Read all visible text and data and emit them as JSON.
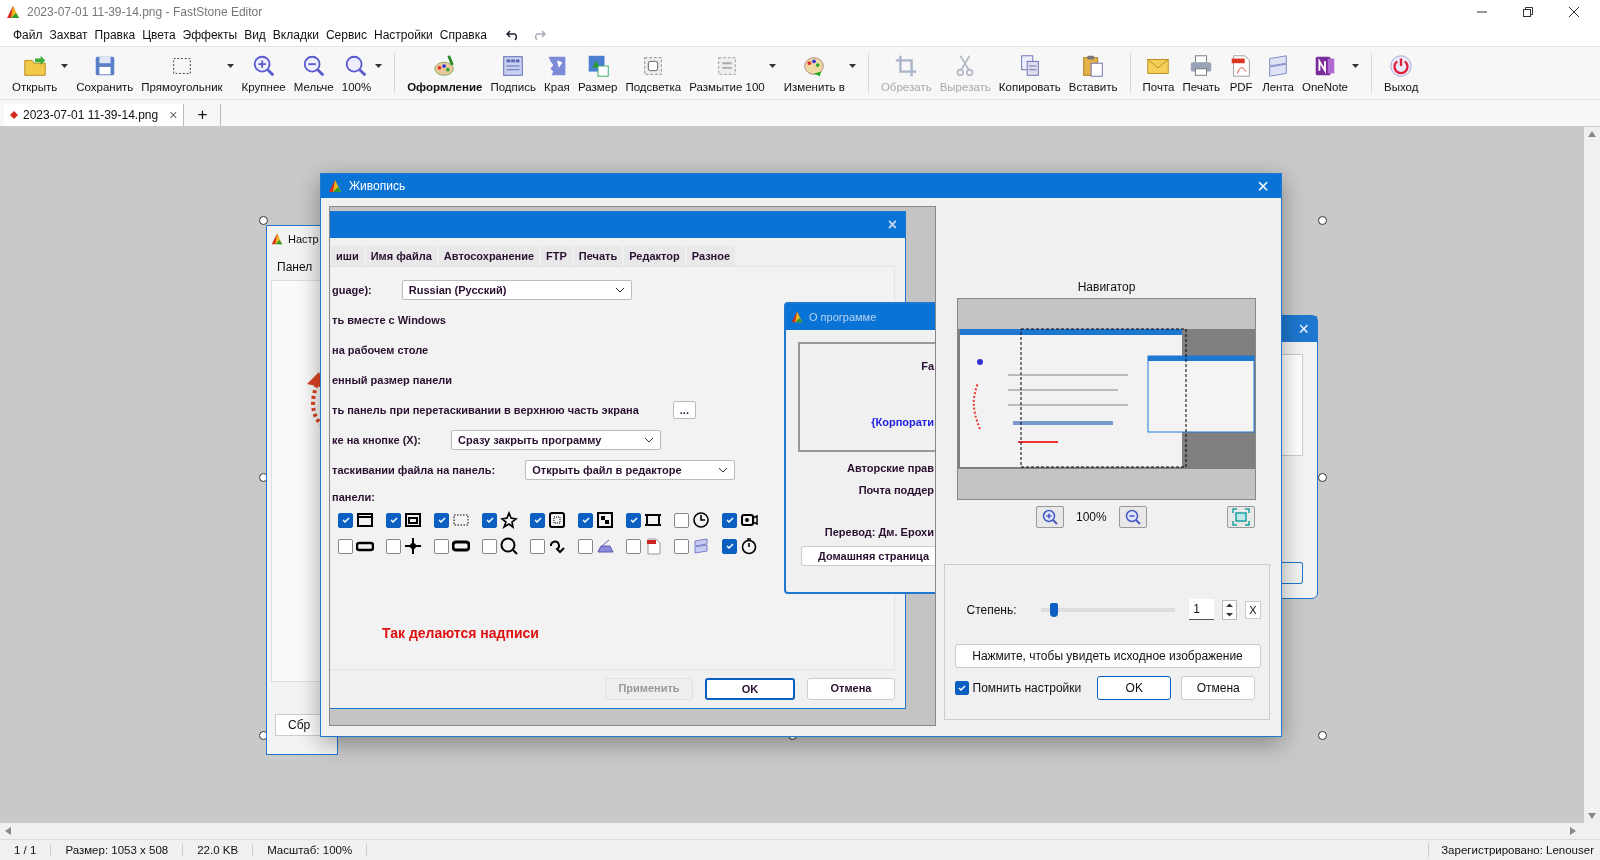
{
  "window": {
    "title": "2023-07-01 11-39-14.png - FastStone Editor"
  },
  "menu": [
    "Файл",
    "Захват",
    "Правка",
    "Цвета",
    "Эффекты",
    "Вид",
    "Вкладки",
    "Сервис",
    "Настройки",
    "Справка"
  ],
  "toolbar": {
    "groups": [
      [
        {
          "label": "Открыть",
          "disabled": false,
          "selected": false,
          "dropdown": true
        },
        {
          "label": "Сохранить",
          "disabled": false,
          "selected": false,
          "dropdown": false
        },
        {
          "label": "Прямоугольник",
          "disabled": false,
          "selected": false,
          "dropdown": true
        },
        {
          "label": "Крупнее",
          "disabled": false,
          "selected": false,
          "dropdown": false
        },
        {
          "label": "Мельче",
          "disabled": false,
          "selected": false,
          "dropdown": false
        },
        {
          "label": "100%",
          "disabled": false,
          "selected": false,
          "dropdown": true
        }
      ],
      [
        {
          "label": "Оформление",
          "disabled": false,
          "selected": true,
          "dropdown": false
        },
        {
          "label": "Подпись",
          "disabled": false,
          "selected": false,
          "dropdown": false
        },
        {
          "label": "Края",
          "disabled": false,
          "selected": false,
          "dropdown": false
        },
        {
          "label": "Размер",
          "disabled": false,
          "selected": false,
          "dropdown": false
        },
        {
          "label": "Подсветка",
          "disabled": false,
          "selected": false,
          "dropdown": false
        },
        {
          "label": "Размытие 100",
          "disabled": false,
          "selected": false,
          "dropdown": true
        },
        {
          "label": "Изменить в",
          "disabled": false,
          "selected": false,
          "dropdown": true
        }
      ],
      [
        {
          "label": "Обрезать",
          "disabled": true,
          "selected": false,
          "dropdown": false
        },
        {
          "label": "Вырезать",
          "disabled": true,
          "selected": false,
          "dropdown": false
        },
        {
          "label": "Копировать",
          "disabled": false,
          "selected": false,
          "dropdown": false
        },
        {
          "label": "Вставить",
          "disabled": false,
          "selected": false,
          "dropdown": false
        }
      ],
      [
        {
          "label": "Почта",
          "disabled": false,
          "selected": false,
          "dropdown": false
        },
        {
          "label": "Печать",
          "disabled": false,
          "selected": false,
          "dropdown": false
        },
        {
          "label": "PDF",
          "disabled": false,
          "selected": false,
          "dropdown": false
        },
        {
          "label": "Лента",
          "disabled": false,
          "selected": false,
          "dropdown": false
        },
        {
          "label": "OneNote",
          "disabled": false,
          "selected": false,
          "dropdown": true
        }
      ],
      [
        {
          "label": "Выход",
          "disabled": false,
          "selected": false,
          "dropdown": false
        }
      ]
    ]
  },
  "tabs": [
    {
      "label": "2023-07-01 11-39-14.png",
      "selected": true,
      "modified": true,
      "close": "×"
    }
  ],
  "new_tab": "+",
  "background": {
    "left_window": {
      "title": "Настр",
      "tab": "Панел",
      "button": "Сбр"
    },
    "right_window": {
      "close": "×"
    }
  },
  "dialog": {
    "title": "Живопись",
    "close": "×",
    "preview": {
      "settings": {
        "close": "×",
        "tabs": [
          "иши",
          "Имя файла",
          "Автосохранение",
          "FTP",
          "Печать",
          "Редактор",
          "Разное"
        ],
        "rows": [
          {
            "kind": "dropdown",
            "label": "guage):",
            "value": "Russian (Русский)"
          },
          {
            "kind": "text",
            "label": "ть вместе с Windows"
          },
          {
            "kind": "text",
            "label": "на рабочем столе"
          },
          {
            "kind": "text",
            "label": "енный размер панели"
          },
          {
            "kind": "button",
            "label": "ть панель при перетаскивании в верхнюю часть экрана",
            "button": "..."
          },
          {
            "kind": "dropdown",
            "label": "ке на кнопке (X):",
            "value": "Сразу закрыть программу"
          },
          {
            "kind": "dropdown",
            "label": "таскивании файла на панель:",
            "value": "Открыть файл в редакторе"
          }
        ],
        "grid_label": "панели:",
        "grid": [
          [
            {
              "checked": true
            },
            {
              "checked": true
            },
            {
              "checked": true
            },
            {
              "checked": true
            },
            {
              "checked": true
            },
            {
              "checked": true
            },
            {
              "checked": true
            },
            {
              "checked": false
            },
            {
              "checked": true
            }
          ],
          [
            {
              "checked": false
            },
            {
              "checked": false
            },
            {
              "checked": false
            },
            {
              "checked": false
            },
            {
              "checked": false
            },
            {
              "checked": false
            },
            {
              "checked": false
            },
            {
              "checked": false
            },
            {
              "checked": true
            }
          ]
        ],
        "caption": "Так делаются надписи",
        "buttons": [
          {
            "label": "Применить",
            "disabled": true,
            "default": false
          },
          {
            "label": "OK",
            "disabled": false,
            "default": true
          },
          {
            "label": "Отмена",
            "disabled": false,
            "default": false
          }
        ]
      },
      "about": {
        "title": "О программе",
        "product": "Fa",
        "company": "{Корпорати",
        "lines": [
          "Авторские прав",
          "Почта поддер",
          "Перевод: Дм. Ерохи"
        ],
        "button": "Домашняя страница"
      }
    },
    "navigator": {
      "title": "Навигатор",
      "zoom": "100%"
    },
    "strength": {
      "label": "Степень:",
      "level": 0.1,
      "value": "1",
      "reset": "X"
    },
    "show_original": "Нажмите, чтобы увидеть исходное изображение",
    "remember": {
      "label": "Помнить настройки",
      "checked": true
    },
    "buttons": [
      {
        "label": "OK",
        "default": true
      },
      {
        "label": "Отмена",
        "default": false
      }
    ]
  },
  "status_bar": [
    "1 / 1",
    "Размер: 1053 x 508",
    "22.0 KB",
    "Масштаб: 100%"
  ],
  "registration": "Зарегистрировано: Lenouser"
}
